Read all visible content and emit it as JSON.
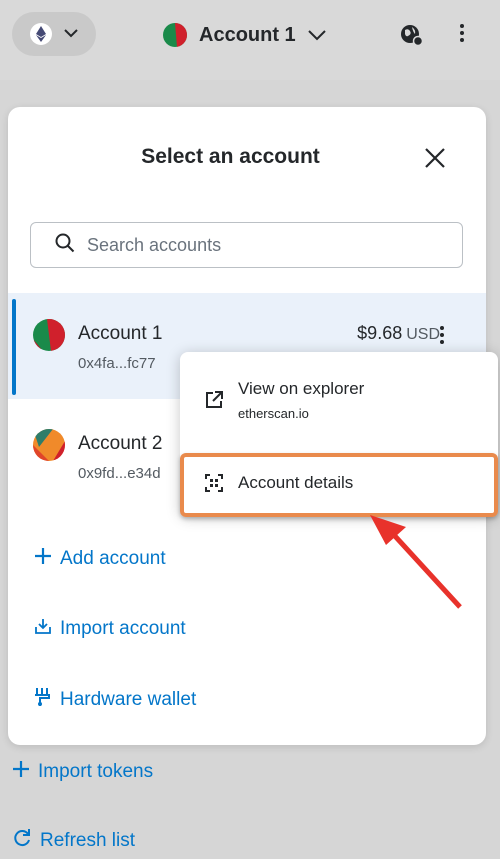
{
  "header": {
    "network_icon": "ethereum-icon",
    "account_name": "Account 1",
    "icons": [
      "chevron-down-icon",
      "globe-icon",
      "kebab-menu-icon"
    ]
  },
  "modal": {
    "title": "Select an account",
    "search_placeholder": "Search accounts",
    "accounts": [
      {
        "name": "Account 1",
        "address": "0x4fa...fc77",
        "balance": "$9.68",
        "currency": "USD",
        "selected": true
      },
      {
        "name": "Account 2",
        "address": "0x9fd...e34d"
      }
    ],
    "actions": {
      "add": "Add account",
      "import": "Import account",
      "hardware": "Hardware wallet"
    }
  },
  "popup": {
    "explorer_label": "View on explorer",
    "explorer_sub": "etherscan.io",
    "details_label": "Account details"
  },
  "page_links": {
    "import_tokens": "Import tokens",
    "refresh": "Refresh list"
  },
  "colors": {
    "accent": "#0376c9",
    "highlight": "#e98a4c",
    "arrow": "#e8322b"
  }
}
